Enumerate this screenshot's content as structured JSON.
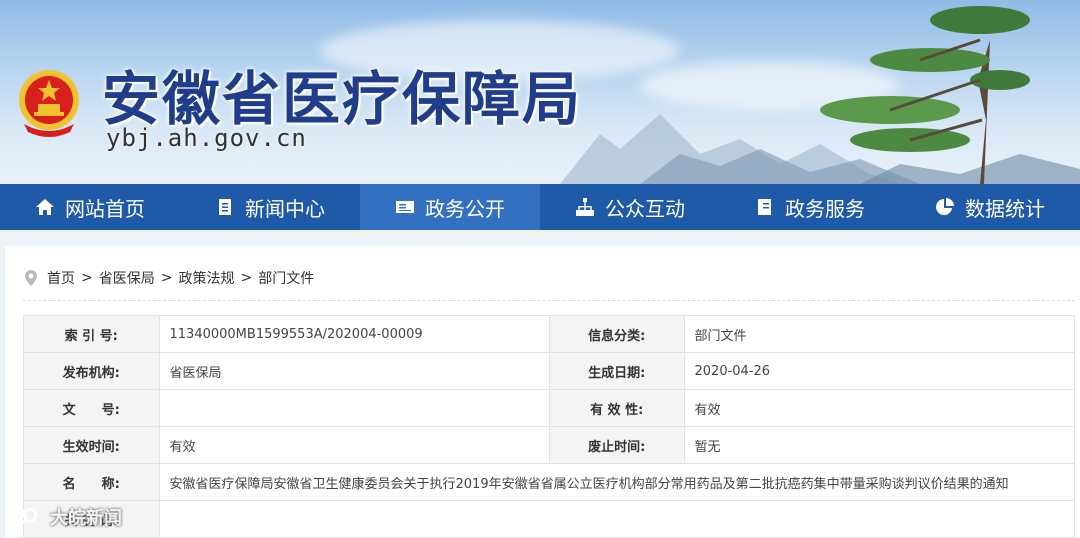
{
  "header": {
    "title": "安徽省医疗保障局",
    "url": "ybj.ah.gov.cn"
  },
  "nav": {
    "items": [
      {
        "label": "网站首页",
        "icon": "home-icon"
      },
      {
        "label": "新闻中心",
        "icon": "document-icon"
      },
      {
        "label": "政务公开",
        "icon": "id-card-icon"
      },
      {
        "label": "公众互动",
        "icon": "org-chart-icon"
      },
      {
        "label": "政务服务",
        "icon": "book-icon"
      },
      {
        "label": "数据统计",
        "icon": "pie-chart-icon"
      }
    ],
    "active_index": 2
  },
  "breadcrumb": {
    "icon": "location-pin-icon",
    "items": [
      "首页",
      "省医保局",
      "政策法规",
      "部门文件"
    ],
    "separator": ">"
  },
  "info": {
    "index_label": "索 引 号:",
    "index_value": "11340000MB1599553A/202004-00009",
    "category_label": "信息分类:",
    "category_value": "部门文件",
    "publisher_label": "发布机构:",
    "publisher_value": "省医保局",
    "date_label": "生成日期:",
    "date_value": "2020-04-26",
    "docno_label": "文　　号:",
    "docno_value": "",
    "validity_label": "有 效 性:",
    "validity_value": "有效",
    "effective_label": "生效时间:",
    "effective_value": "有效",
    "repeal_label": "废止时间:",
    "repeal_value": "暂无",
    "name_label": "名　　称:",
    "name_value": "安徽省医疗保障局安徽省卫生健康委员会关于执行2019年安徽省省属公立医疗机构部分常用药品及第二批抗癌药集中带量采购谈判议价结果的通知",
    "keywords_label": "关 键 词:",
    "keywords_value": ""
  },
  "watermark": {
    "text": "大皖新闻"
  },
  "colors": {
    "nav_bg": "#1f5aa8",
    "nav_active": "#3470c2",
    "title": "#1f3d8a",
    "emblem_red": "#d7201b",
    "emblem_gold": "#f2c230"
  }
}
